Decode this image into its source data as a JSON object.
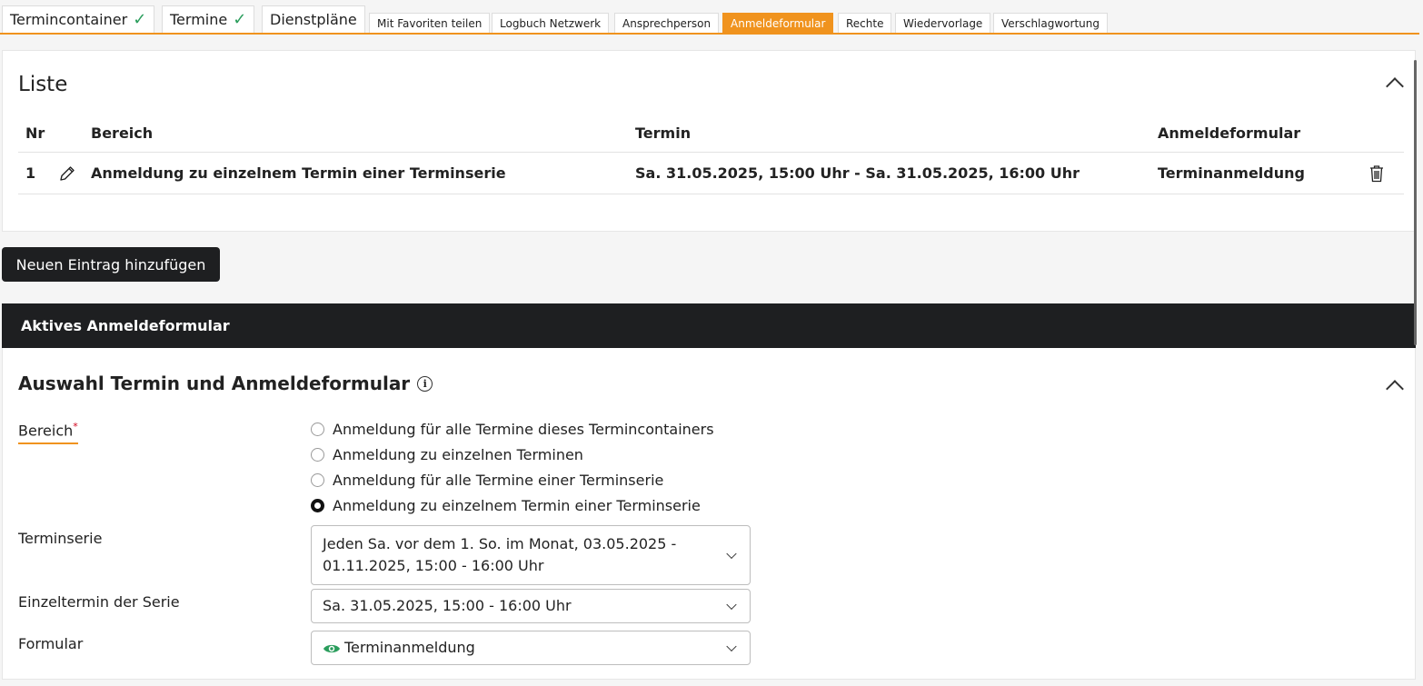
{
  "tabs": {
    "main": [
      {
        "label": "Termincontainer",
        "checked": true
      },
      {
        "label": "Termine",
        "checked": true
      },
      {
        "label": "Dienstpläne",
        "checked": false
      }
    ],
    "sub": [
      {
        "label": "Mit Favoriten teilen"
      },
      {
        "label": "Logbuch Netzwerk"
      },
      {
        "label": "Ansprechperson"
      },
      {
        "label": "Anmeldeformular",
        "active": true
      },
      {
        "label": "Rechte"
      },
      {
        "label": "Wiedervorlage"
      },
      {
        "label": "Verschlagwortung"
      }
    ],
    "check_icon": "checkmark-icon"
  },
  "liste": {
    "title": "Liste",
    "columns": [
      "Nr",
      "Bereich",
      "Termin",
      "Anmeldeformular"
    ],
    "rows": [
      {
        "nr": "1",
        "bereich": "Anmeldung zu einzelnem Termin einer Terminserie",
        "termin": "Sa. 31.05.2025, 15:00 Uhr - Sa. 31.05.2025, 16:00 Uhr",
        "anmeldeformular": "Terminanmeldung"
      }
    ]
  },
  "add_button": "Neuen Eintrag hinzufügen",
  "active_form": {
    "header": "Aktives Anmeldeformular",
    "title": "Auswahl Termin und Anmeldeformular",
    "bereich_label": "Bereich",
    "required_mark": "*",
    "options": [
      {
        "label": "Anmeldung für alle Termine dieses Termincontainers",
        "checked": false
      },
      {
        "label": "Anmeldung zu einzelnen Terminen",
        "checked": false
      },
      {
        "label": "Anmeldung für alle Termine einer Terminserie",
        "checked": false
      },
      {
        "label": "Anmeldung zu einzelnem Termin einer Terminserie",
        "checked": true
      }
    ],
    "terminserie_label": "Terminserie",
    "terminserie_value": "Jeden Sa. vor dem 1. So. im Monat, 03.05.2025 - 01.11.2025, 15:00 - 16:00 Uhr",
    "einzeltermin_label": "Einzeltermin der Serie",
    "einzeltermin_value": "Sa. 31.05.2025, 15:00 - 16:00 Uhr",
    "formular_label": "Formular",
    "formular_value": "Terminanmeldung"
  },
  "colors": {
    "accent": "#f0931e",
    "dark": "#1e1f21",
    "check": "#2a9d5c",
    "eye": "#2a9d5c",
    "required": "#d0021b"
  }
}
